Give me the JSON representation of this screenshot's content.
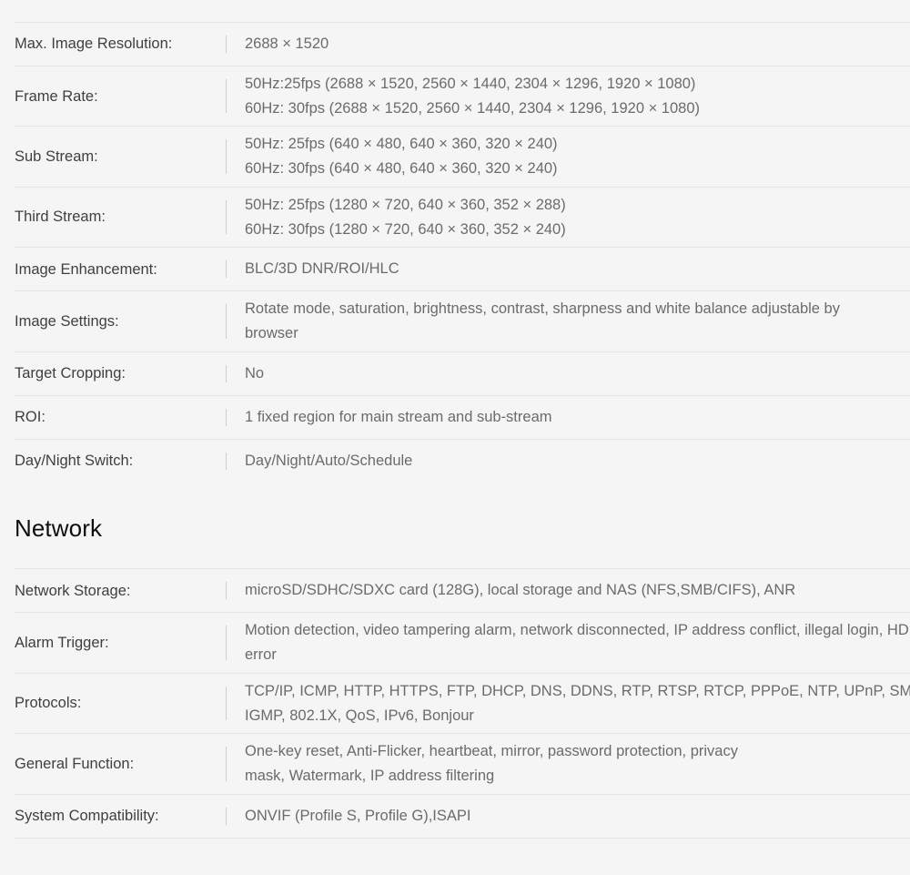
{
  "sections": [
    {
      "heading": null,
      "rows": [
        {
          "label": "Max. Image Resolution:",
          "value": "2688 × 1520"
        },
        {
          "label": "Frame Rate:",
          "value": "50Hz:25fps (2688 × 1520, 2560 × 1440, 2304 × 1296, 1920 × 1080)\n60Hz: 30fps (2688 × 1520, 2560 × 1440, 2304 × 1296, 1920 × 1080)"
        },
        {
          "label": "Sub Stream:",
          "value": "50Hz: 25fps (640 × 480, 640 × 360, 320 × 240)\n60Hz: 30fps (640 × 480, 640 × 360, 320 × 240)"
        },
        {
          "label": "Third Stream:",
          "value": "50Hz: 25fps (1280 × 720, 640 × 360, 352 × 288)\n60Hz: 30fps (1280 × 720, 640 × 360, 352 × 240)"
        },
        {
          "label": "Image Enhancement:",
          "value": "BLC/3D DNR/ROI/HLC"
        },
        {
          "label": "Image Settings:",
          "value": "Rotate mode, saturation, brightness, contrast, sharpness and white balance adjustable by\nbrowser"
        },
        {
          "label": "Target Cropping:",
          "value": "No"
        },
        {
          "label": "ROI:",
          "value": "1 fixed region for main stream and sub-stream"
        },
        {
          "label": "Day/Night Switch:",
          "value": "Day/Night/Auto/Schedule"
        }
      ]
    },
    {
      "heading": "Network",
      "rows": [
        {
          "label": "Network Storage:",
          "value": "microSD/SDHC/SDXC card (128G), local storage and NAS (NFS,SMB/CIFS), ANR"
        },
        {
          "label": "Alarm Trigger:",
          "value": "Motion detection, video tampering alarm, network disconnected, IP address conflict, illegal login, HDD\nerror"
        },
        {
          "label": "Protocols:",
          "value": "TCP/IP, ICMP, HTTP, HTTPS, FTP, DHCP, DNS, DDNS, RTP, RTSP, RTCP, PPPoE, NTP, UPnP, SMTP, SNMP,\nIGMP, 802.1X, QoS, IPv6, Bonjour"
        },
        {
          "label": "General Function:",
          "value": "One-key reset, Anti-Flicker, heartbeat, mirror, password protection, privacy\nmask, Watermark, IP address filtering"
        },
        {
          "label": "System Compatibility:",
          "value": "ONVIF (Profile S, Profile G),ISAPI"
        }
      ]
    }
  ]
}
